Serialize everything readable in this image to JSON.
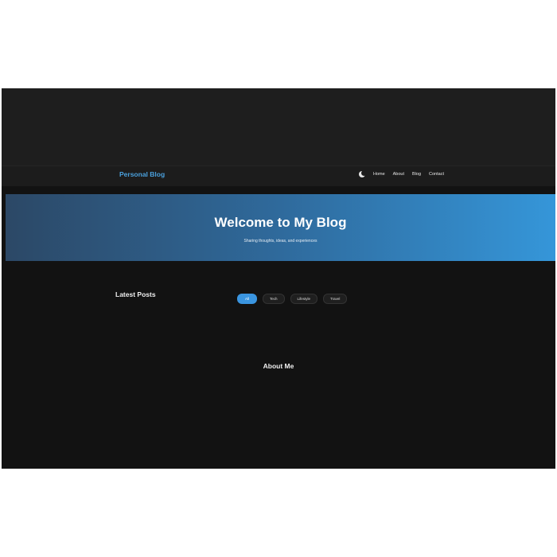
{
  "site": {
    "brand": "Personal Blog",
    "nav": {
      "theme_toggle_icon": "moon-icon",
      "links": [
        "Home",
        "About",
        "Blog",
        "Contact"
      ]
    }
  },
  "hero": {
    "title": "Welcome to My Blog",
    "subtitle": "Sharing thoughts, ideas, and experiences"
  },
  "posts": {
    "title": "Latest Posts",
    "filters": [
      "All",
      "Tech",
      "Lifestyle",
      "Travel"
    ],
    "active_filter": "All"
  },
  "about": {
    "title": "About Me"
  },
  "colors": {
    "accent": "#3a95e0",
    "brand": "#4aa0dc",
    "background": "#121212",
    "hero_gradient_start": "#2c4866",
    "hero_gradient_end": "#3596d9"
  }
}
